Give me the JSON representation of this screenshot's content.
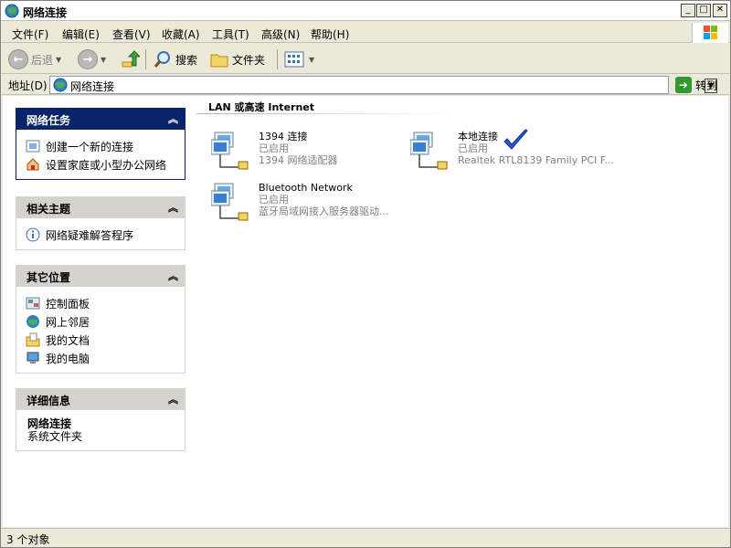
{
  "window": {
    "title": "网络连接",
    "min_label": "_",
    "max_label": "□",
    "close_label": "✕"
  },
  "menu": {
    "items": [
      "文件(F)",
      "编辑(E)",
      "查看(V)",
      "收藏(A)",
      "工具(T)",
      "高级(N)",
      "帮助(H)"
    ]
  },
  "toolbar": {
    "back_label": "后退",
    "search_label": "搜索",
    "folders_label": "文件夹"
  },
  "address": {
    "label": "地址(D)",
    "value": "网络连接",
    "go_label": "转到"
  },
  "panels": {
    "network_tasks": {
      "title": "网络任务",
      "items": [
        "创建一个新的连接",
        "设置家庭或小型办公网络"
      ]
    },
    "related": {
      "title": "相关主题",
      "items": [
        "网络疑难解答程序"
      ]
    },
    "other_places": {
      "title": "其它位置",
      "items": [
        "控制面板",
        "网上邻居",
        "我的文档",
        "我的电脑"
      ]
    },
    "details": {
      "title": "详细信息",
      "name": "网络连接",
      "desc": "系统文件夹"
    }
  },
  "main": {
    "section_title": "LAN 或高速 Internet",
    "connections": [
      {
        "name": "1394 连接",
        "status": "已启用",
        "device": "1394 网络适配器"
      },
      {
        "name": "本地连接",
        "status": "已启用",
        "device": "Realtek RTL8139 Family PCI F..."
      },
      {
        "name": "Bluetooth Network",
        "status": "已启用",
        "device": "蓝牙局域网接入服务器驱动..."
      }
    ]
  },
  "status": {
    "text": "3 个对象"
  },
  "colors": {
    "panel_dark": "#0a246a",
    "panel_light": "#d6d3ce",
    "chrome": "#ece9d8",
    "checkmark": "#1f5fd1"
  }
}
